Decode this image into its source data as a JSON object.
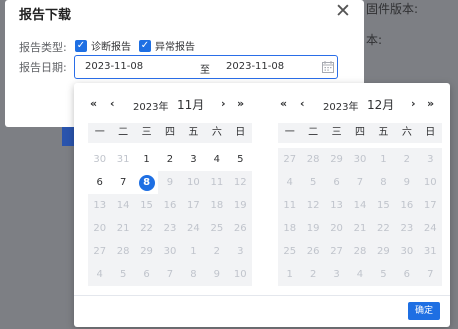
{
  "background": {
    "firmware_label": "固件版本:",
    "partial_label": "本:"
  },
  "dialog": {
    "title": "报告下载",
    "close": "✕",
    "report_type_label": "报告类型:",
    "report_date_label": "报告日期:",
    "checkbox_diagnosis": "诊断报告",
    "checkbox_abnormal": "异常报告",
    "start_date": "2023-11-08",
    "separator": "至",
    "end_date": "2023-11-08"
  },
  "picker": {
    "confirm": "确定",
    "left": {
      "year": "2023年",
      "month": "11月",
      "weekdays": [
        "一",
        "二",
        "三",
        "四",
        "五",
        "六",
        "日"
      ],
      "days": [
        [
          "30",
          "other"
        ],
        [
          "31",
          "other"
        ],
        [
          "1",
          "current"
        ],
        [
          "2",
          "current"
        ],
        [
          "3",
          "current"
        ],
        [
          "4",
          "current"
        ],
        [
          "5",
          "current"
        ],
        [
          "6",
          "current"
        ],
        [
          "7",
          "current"
        ],
        [
          "8",
          "selected"
        ],
        [
          "9",
          "disabled"
        ],
        [
          "10",
          "disabled"
        ],
        [
          "11",
          "disabled"
        ],
        [
          "12",
          "disabled"
        ],
        [
          "13",
          "disabled"
        ],
        [
          "14",
          "disabled"
        ],
        [
          "15",
          "disabled"
        ],
        [
          "16",
          "disabled"
        ],
        [
          "17",
          "disabled"
        ],
        [
          "18",
          "disabled"
        ],
        [
          "19",
          "disabled"
        ],
        [
          "20",
          "disabled"
        ],
        [
          "21",
          "disabled"
        ],
        [
          "22",
          "disabled"
        ],
        [
          "23",
          "disabled"
        ],
        [
          "24",
          "disabled"
        ],
        [
          "25",
          "disabled"
        ],
        [
          "26",
          "disabled"
        ],
        [
          "27",
          "disabled"
        ],
        [
          "28",
          "disabled"
        ],
        [
          "29",
          "disabled"
        ],
        [
          "30",
          "disabled"
        ],
        [
          "1",
          "disabled"
        ],
        [
          "2",
          "disabled"
        ],
        [
          "3",
          "disabled"
        ],
        [
          "4",
          "disabled"
        ],
        [
          "5",
          "disabled"
        ],
        [
          "6",
          "disabled"
        ],
        [
          "7",
          "disabled"
        ],
        [
          "8",
          "disabled"
        ],
        [
          "9",
          "disabled"
        ],
        [
          "10",
          "disabled"
        ]
      ]
    },
    "right": {
      "year": "2023年",
      "month": "12月",
      "weekdays": [
        "一",
        "二",
        "三",
        "四",
        "五",
        "六",
        "日"
      ],
      "days": [
        [
          "27",
          "disabled"
        ],
        [
          "28",
          "disabled"
        ],
        [
          "29",
          "disabled"
        ],
        [
          "30",
          "disabled"
        ],
        [
          "1",
          "disabled"
        ],
        [
          "2",
          "disabled"
        ],
        [
          "3",
          "disabled"
        ],
        [
          "4",
          "disabled"
        ],
        [
          "5",
          "disabled"
        ],
        [
          "6",
          "disabled"
        ],
        [
          "7",
          "disabled"
        ],
        [
          "8",
          "disabled"
        ],
        [
          "9",
          "disabled"
        ],
        [
          "10",
          "disabled"
        ],
        [
          "11",
          "disabled"
        ],
        [
          "12",
          "disabled"
        ],
        [
          "13",
          "disabled"
        ],
        [
          "14",
          "disabled"
        ],
        [
          "15",
          "disabled"
        ],
        [
          "16",
          "disabled"
        ],
        [
          "17",
          "disabled"
        ],
        [
          "18",
          "disabled"
        ],
        [
          "19",
          "disabled"
        ],
        [
          "20",
          "disabled"
        ],
        [
          "21",
          "disabled"
        ],
        [
          "22",
          "disabled"
        ],
        [
          "23",
          "disabled"
        ],
        [
          "24",
          "disabled"
        ],
        [
          "25",
          "disabled"
        ],
        [
          "26",
          "disabled"
        ],
        [
          "27",
          "disabled"
        ],
        [
          "28",
          "disabled"
        ],
        [
          "29",
          "disabled"
        ],
        [
          "30",
          "disabled"
        ],
        [
          "31",
          "disabled"
        ],
        [
          "1",
          "disabled"
        ],
        [
          "2",
          "disabled"
        ],
        [
          "3",
          "disabled"
        ],
        [
          "4",
          "disabled"
        ],
        [
          "5",
          "disabled"
        ],
        [
          "6",
          "disabled"
        ],
        [
          "7",
          "disabled"
        ]
      ]
    },
    "nav_labels": {
      "prev_year": "«",
      "prev_month": "‹",
      "next_month": "›",
      "next_year": "»"
    }
  },
  "colors": {
    "accent": "#1e6fe3",
    "overlay": "#7d7f84"
  }
}
